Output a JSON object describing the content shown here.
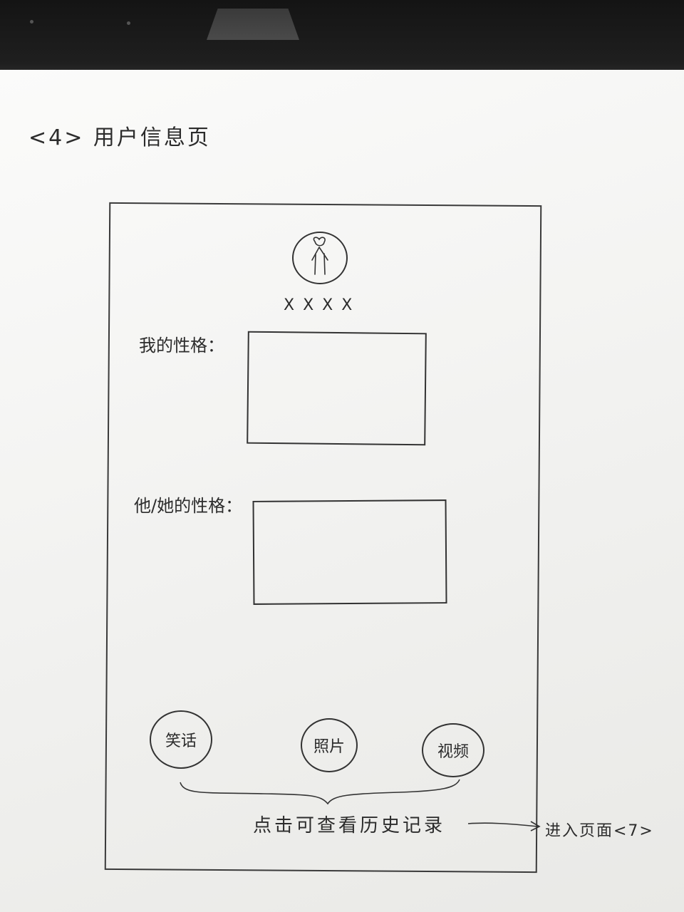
{
  "page": {
    "title": "<4> 用户信息页"
  },
  "profile": {
    "avatar_icon": "person-icon",
    "username": "XXXX"
  },
  "fields": {
    "my_personality_label": "我的性格：",
    "their_personality_label": "他/她的性格："
  },
  "actions": {
    "jokes_label": "笑话",
    "photos_label": "照片",
    "videos_label": "视频"
  },
  "annotation": {
    "hint": "点击可查看历史记录",
    "goto": "进入页面<7>"
  }
}
